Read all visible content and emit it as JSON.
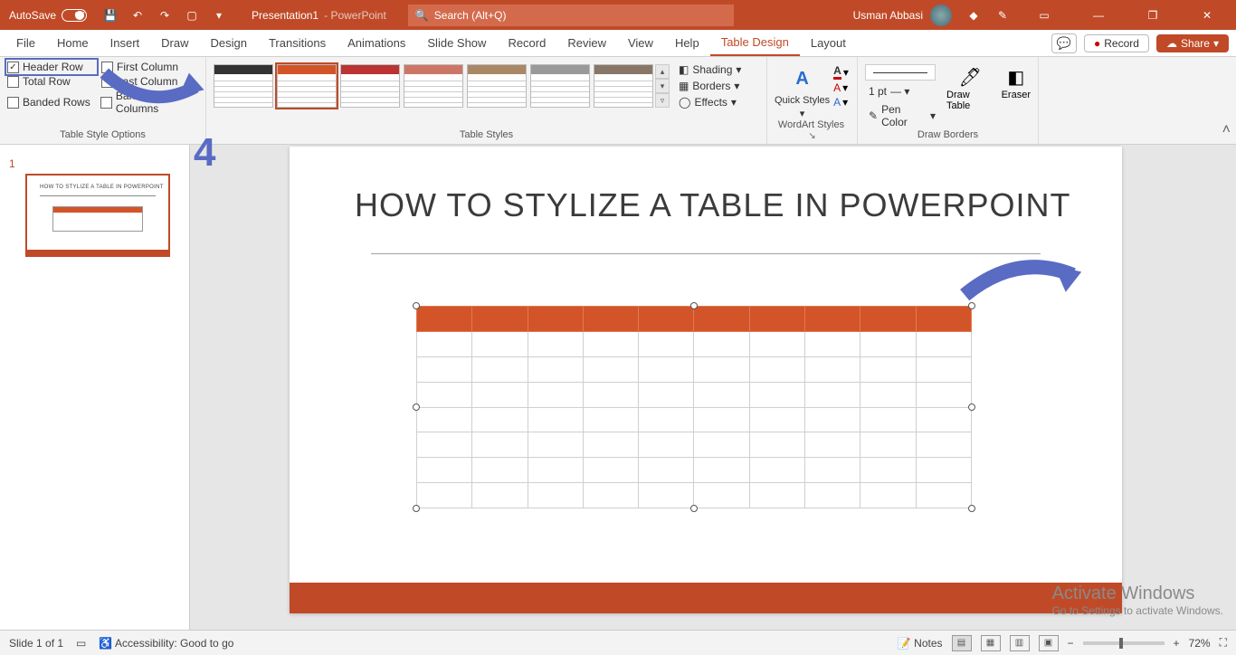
{
  "titlebar": {
    "autosave": "AutoSave",
    "toggle": "Off",
    "doc": "Presentation1",
    "app": "PowerPoint",
    "search_placeholder": "Search (Alt+Q)",
    "user": "Usman Abbasi"
  },
  "tabs": {
    "file": "File",
    "home": "Home",
    "insert": "Insert",
    "draw": "Draw",
    "design": "Design",
    "transitions": "Transitions",
    "animations": "Animations",
    "slideshow": "Slide Show",
    "record_tab": "Record",
    "review": "Review",
    "view": "View",
    "help": "Help",
    "table_design": "Table Design",
    "layout": "Layout",
    "record_btn": "Record",
    "share": "Share"
  },
  "ribbon": {
    "style_options": {
      "header_row": "Header Row",
      "first_column": "First Column",
      "total_row": "Total Row",
      "last_column": "Last Column",
      "banded_rows": "Banded Rows",
      "banded_columns": "Banded Columns",
      "label": "Table Style Options"
    },
    "table_styles": {
      "label": "Table Styles",
      "shading": "Shading",
      "borders": "Borders",
      "effects": "Effects"
    },
    "wordart": {
      "label": "WordArt Styles",
      "quick": "Quick Styles"
    },
    "draw_borders": {
      "label": "Draw Borders",
      "pen_weight": "1 pt",
      "pen_color": "Pen Color",
      "draw_table": "Draw Table",
      "eraser": "Eraser"
    }
  },
  "slide": {
    "number": "1",
    "title": "HOW TO STYLIZE A TABLE IN POWERPOINT",
    "annotation_step": "4"
  },
  "watermark": {
    "line1": "Activate Windows",
    "line2": "Go to Settings to activate Windows."
  },
  "status": {
    "slide": "Slide 1 of 1",
    "accessibility": "Accessibility: Good to go",
    "notes": "Notes",
    "zoom": "72%"
  },
  "colors": {
    "accent": "#c04a27",
    "annotation": "#5a6bc4",
    "table_header": "#d35429"
  }
}
